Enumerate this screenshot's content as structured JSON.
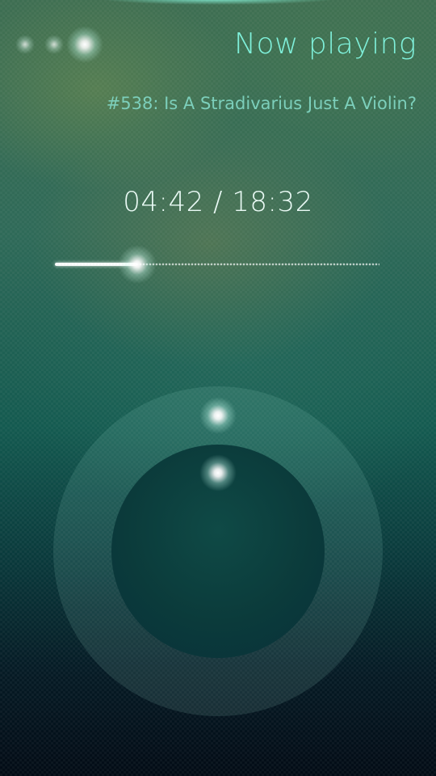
{
  "header": {
    "title": "Now playing",
    "episode_title": "#538: Is A Stradivarius Just A Violin?"
  },
  "playback": {
    "time_display": "04:42 / 18:32",
    "elapsed": "04:42",
    "duration": "18:32",
    "progress_fraction": 0.254
  },
  "pulley_menu_indicator": {
    "dots": 3,
    "active_index": 2
  },
  "colors": {
    "accent": "#7ff0da",
    "secondary_text": "#7ccfbb",
    "primary_text": "#eafaf5"
  },
  "icons": {
    "pulley_dot": "glow-dot-icon",
    "wheel_handle": "glow-dot-icon"
  }
}
